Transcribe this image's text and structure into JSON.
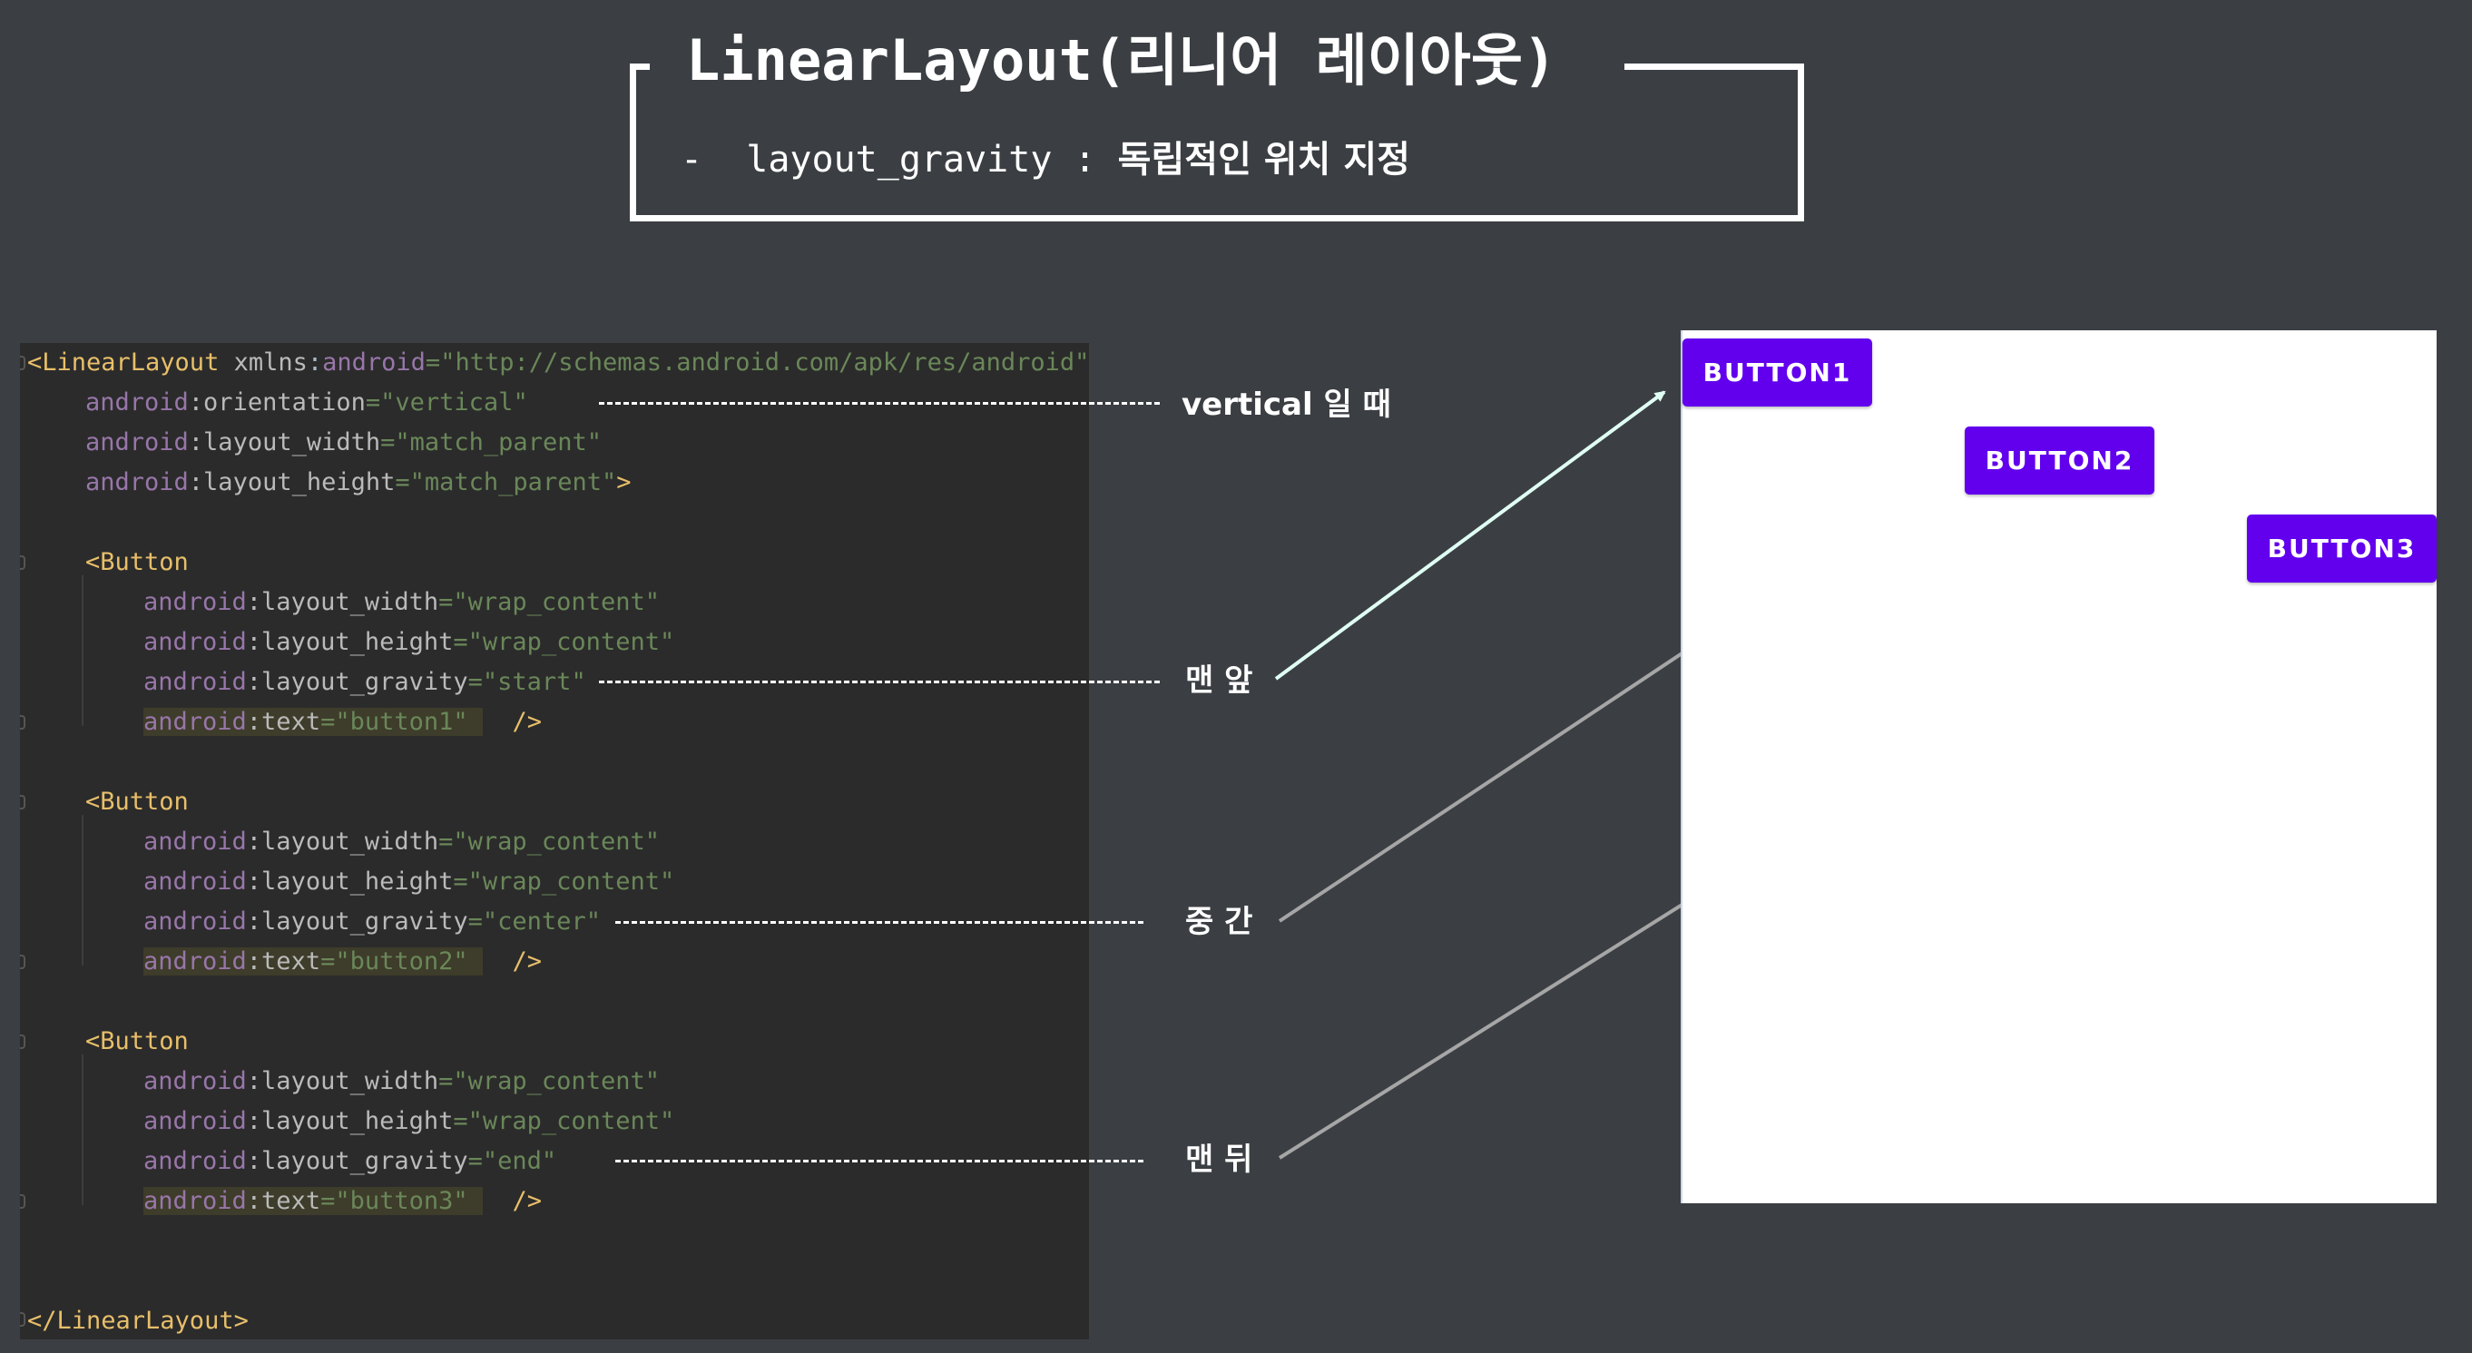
{
  "title": "LinearLayout(리니어 레이아웃)",
  "subtitle": {
    "bullet": "-",
    "term": "layout_gravity :",
    "desc": "독립적인 위치 지정"
  },
  "code": {
    "line1": {
      "open": "<LinearLayout ",
      "xmlns": "xmlns",
      "colon": ":",
      "ns": "android",
      "eq": "=",
      "value": "\"http://schemas.android.com/apk/res/android\""
    },
    "line2": {
      "ns": "android",
      "attr": ":orientation",
      "eq": "=",
      "value": "\"vertical\""
    },
    "line3": {
      "ns": "android",
      "attr": ":layout_width",
      "eq": "=",
      "value": "\"match_parent\""
    },
    "line4": {
      "ns": "android",
      "attr": ":layout_height",
      "eq": "=",
      "value": "\"match_parent\"",
      "close": ">"
    },
    "buttons": [
      {
        "open": "<Button",
        "width": {
          "ns": "android",
          "attr": ":layout_width",
          "eq": "=",
          "value": "\"wrap_content\""
        },
        "height": {
          "ns": "android",
          "attr": ":layout_height",
          "eq": "=",
          "value": "\"wrap_content\""
        },
        "gravity": {
          "ns": "android",
          "attr": ":layout_gravity",
          "eq": "=",
          "value": "\"start\""
        },
        "text": {
          "ns": "android",
          "attr": ":text",
          "eq": "=",
          "value": "\"button1\"",
          "close": "/>"
        }
      },
      {
        "open": "<Button",
        "width": {
          "ns": "android",
          "attr": ":layout_width",
          "eq": "=",
          "value": "\"wrap_content\""
        },
        "height": {
          "ns": "android",
          "attr": ":layout_height",
          "eq": "=",
          "value": "\"wrap_content\""
        },
        "gravity": {
          "ns": "android",
          "attr": ":layout_gravity",
          "eq": "=",
          "value": "\"center\""
        },
        "text": {
          "ns": "android",
          "attr": ":text",
          "eq": "=",
          "value": "\"button2\"",
          "close": "/>"
        }
      },
      {
        "open": "<Button",
        "width": {
          "ns": "android",
          "attr": ":layout_width",
          "eq": "=",
          "value": "\"wrap_content\""
        },
        "height": {
          "ns": "android",
          "attr": ":layout_height",
          "eq": "=",
          "value": "\"wrap_content\""
        },
        "gravity": {
          "ns": "android",
          "attr": ":layout_gravity",
          "eq": "=",
          "value": "\"end\""
        },
        "text": {
          "ns": "android",
          "attr": ":text",
          "eq": "=",
          "value": "\"button3\"",
          "close": "/>"
        }
      }
    ],
    "closing": "</LinearLayout>"
  },
  "annotations": {
    "vertical": "vertical 일 때",
    "start": "맨 앞",
    "center": "중 간",
    "end": "맨 뒤"
  },
  "preview": {
    "buttons": [
      "BUTTON1",
      "BUTTON2",
      "BUTTON3"
    ],
    "button_color": "#6200ee"
  },
  "colors": {
    "background": "#3b3f43",
    "code_background": "#2b2b2b",
    "tag": "#e8bf6a",
    "namespace": "#9876aa",
    "string": "#6a8759",
    "arrow_highlight": "#e0fff4",
    "arrow": "#a6a6a6"
  }
}
